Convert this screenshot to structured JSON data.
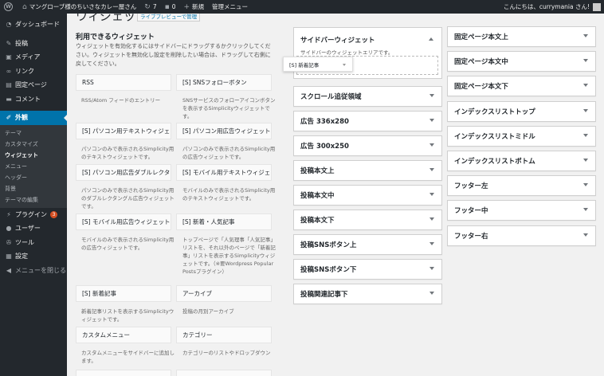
{
  "adminbar": {
    "site_name": "マングローブ様のちいさなカレー屋さん",
    "updates": "7",
    "comments": "0",
    "new_label": "新規",
    "manage_label": "管理メニュー",
    "greeting": "こんにちは、currymania さん!"
  },
  "sidebar": {
    "dashboard": "ダッシュボード",
    "posts": "投稿",
    "media": "メディア",
    "links": "リンク",
    "pages": "固定ページ",
    "comments": "コメント",
    "appearance": "外観",
    "sub": [
      "テーマ",
      "カスタマイズ",
      "ウィジェット",
      "メニュー",
      "ヘッダー",
      "背景",
      "テーマの編集"
    ],
    "plugins": "プラグイン",
    "plugins_badge": "3",
    "users": "ユーザー",
    "tools": "ツール",
    "settings": "設定",
    "collapse": "メニューを閉じる"
  },
  "page": {
    "title": "ウィジェット",
    "title_action": "ライブプレビューで管理",
    "available_title": "利用できるウィジェット",
    "available_desc": "ウィジェットを有効化するにはサイドバーにドラッグするかクリックしてください。ウィジェットを無効化し設定を削除したい場合は、ドラッグして右側に戻してください。"
  },
  "widgets": [
    {
      "title": "RSS",
      "desc": "RSS/Atom フィードのエントリー"
    },
    {
      "title": "[S] SNSフォローボタン",
      "desc": "SNSサービスのフォローアイコンボタンを表示するSimplicityウィジェットです。"
    },
    {
      "title": "[S] パソコン用テキストウィジェ…",
      "desc": "パソコンのみで表示されるSimplicity用のテキストウィジェットです。"
    },
    {
      "title": "[S] パソコン用広告ウィジェット",
      "desc": "パソコンのみで表示されるSimplicity用の広告ウィジェットです。"
    },
    {
      "title": "[S] パソコン用広告ダブルレクタ…",
      "desc": "パソコンのみで表示されるSimplicity用のダブルレクタングル広告ウィジェットです。"
    },
    {
      "title": "[S] モバイル用テキストウィジェ…",
      "desc": "モバイルのみで表示されるSimplicity用のテキストウィジェットです。"
    },
    {
      "title": "[S] モバイル用広告ウィジェット",
      "desc": "モバイルのみで表示されるSimplicity用の広告ウィジェットです。"
    },
    {
      "title": "[S] 新着・人気記事",
      "desc": "トップページで「人気理事「人気記事」リストを、それ以外のページで「新着記事」リストを表示するSimplicityウィジェットです。（※要Wordpress Popular Postsプラグイン）"
    },
    {
      "title": "[S] 新着記事",
      "desc": "新着記事リストを表示するSimplicityウィジェットです。"
    },
    {
      "title": "アーカイブ",
      "desc": "投稿の月別アーカイブ"
    },
    {
      "title": "カスタムメニュー",
      "desc": "カスタムメニューをサイドバーに追加します。"
    },
    {
      "title": "カテゴリー",
      "desc": "カテゴリーのリストやドロップダウン"
    }
  ],
  "sidebar_area": {
    "title": "サイドバーウィジェット",
    "desc": "サイドバーのウィジェットエリアです。",
    "dragging_widget": "[S] 新着記事"
  },
  "areas_col1": [
    "スクロール追従領域",
    "広告 336x280",
    "広告 300x250",
    "投稿本文上",
    "投稿本文中",
    "投稿本文下",
    "投稿SNSボタン上",
    "投稿SNSボタン下",
    "投稿関連記事下"
  ],
  "areas_col2": [
    "固定ページ本文上",
    "固定ページ本文中",
    "固定ページ本文下",
    "インデックスリストトップ",
    "インデックスリストミドル",
    "インデックスリストボトム",
    "フッター左",
    "フッター中",
    "フッター右"
  ]
}
